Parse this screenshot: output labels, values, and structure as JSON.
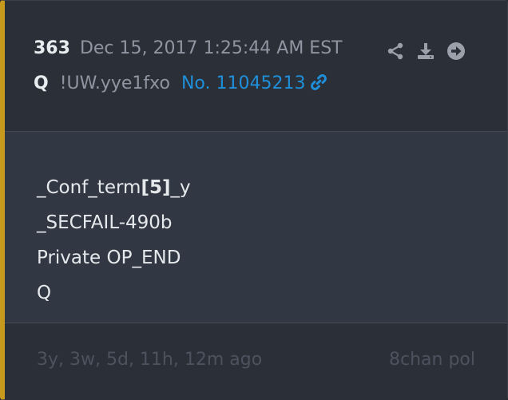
{
  "post": {
    "number": "363",
    "date": "Dec 15, 2017 1:25:44 AM EST",
    "author": "Q",
    "tripcode": "!UW.yye1fxo",
    "post_no": "No. 11045213",
    "body": {
      "line1_prefix": "_Conf_term",
      "line1_bold": "[5]",
      "line1_suffix": "_y",
      "line2": "_SECFAIL-490b",
      "line3": "Private OP_END",
      "line4": "Q"
    },
    "relative_time": "3y, 3w, 5d, 11h, 12m ago",
    "source": "8chan pol"
  },
  "colors": {
    "accent_bar": "#c79a1e",
    "link": "#1f8fd9",
    "muted": "#8f96a1"
  },
  "icons": [
    "share-icon",
    "download-icon",
    "arrow-right-circle-icon",
    "link-icon"
  ]
}
